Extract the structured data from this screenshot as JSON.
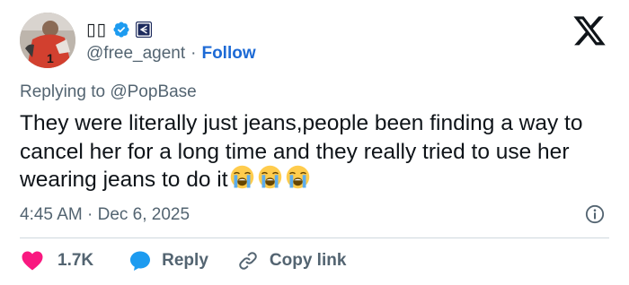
{
  "author": {
    "display_name": "▯▯",
    "handle": "@free_agent",
    "separator": "·",
    "follow_label": "Follow"
  },
  "tweet": {
    "replying_prefix": "Replying to ",
    "replying_to": "@PopBase",
    "text": "They were literally just jeans,people been finding a way to cancel her for a long time and they really tried to use her wearing jeans to do it",
    "emojis": [
      "loudly-crying-face",
      "loudly-crying-face",
      "loudly-crying-face"
    ],
    "timestamp": "4:45 AM · Dec 6, 2025"
  },
  "actions": {
    "like_count": "1.7K",
    "reply_label": "Reply",
    "copy_link_label": "Copy link"
  },
  "colors": {
    "link_blue": "#1d6ad5",
    "verified_blue": "#1d9bf0",
    "like_red": "#f91880",
    "muted_text": "#536471"
  },
  "icons": {
    "verified": "verified-badge-icon",
    "affiliate": "affiliate-badge-icon",
    "brand": "x-logo-icon",
    "info": "info-icon",
    "like": "heart-icon",
    "reply": "speech-bubble-icon",
    "copy": "link-icon"
  }
}
